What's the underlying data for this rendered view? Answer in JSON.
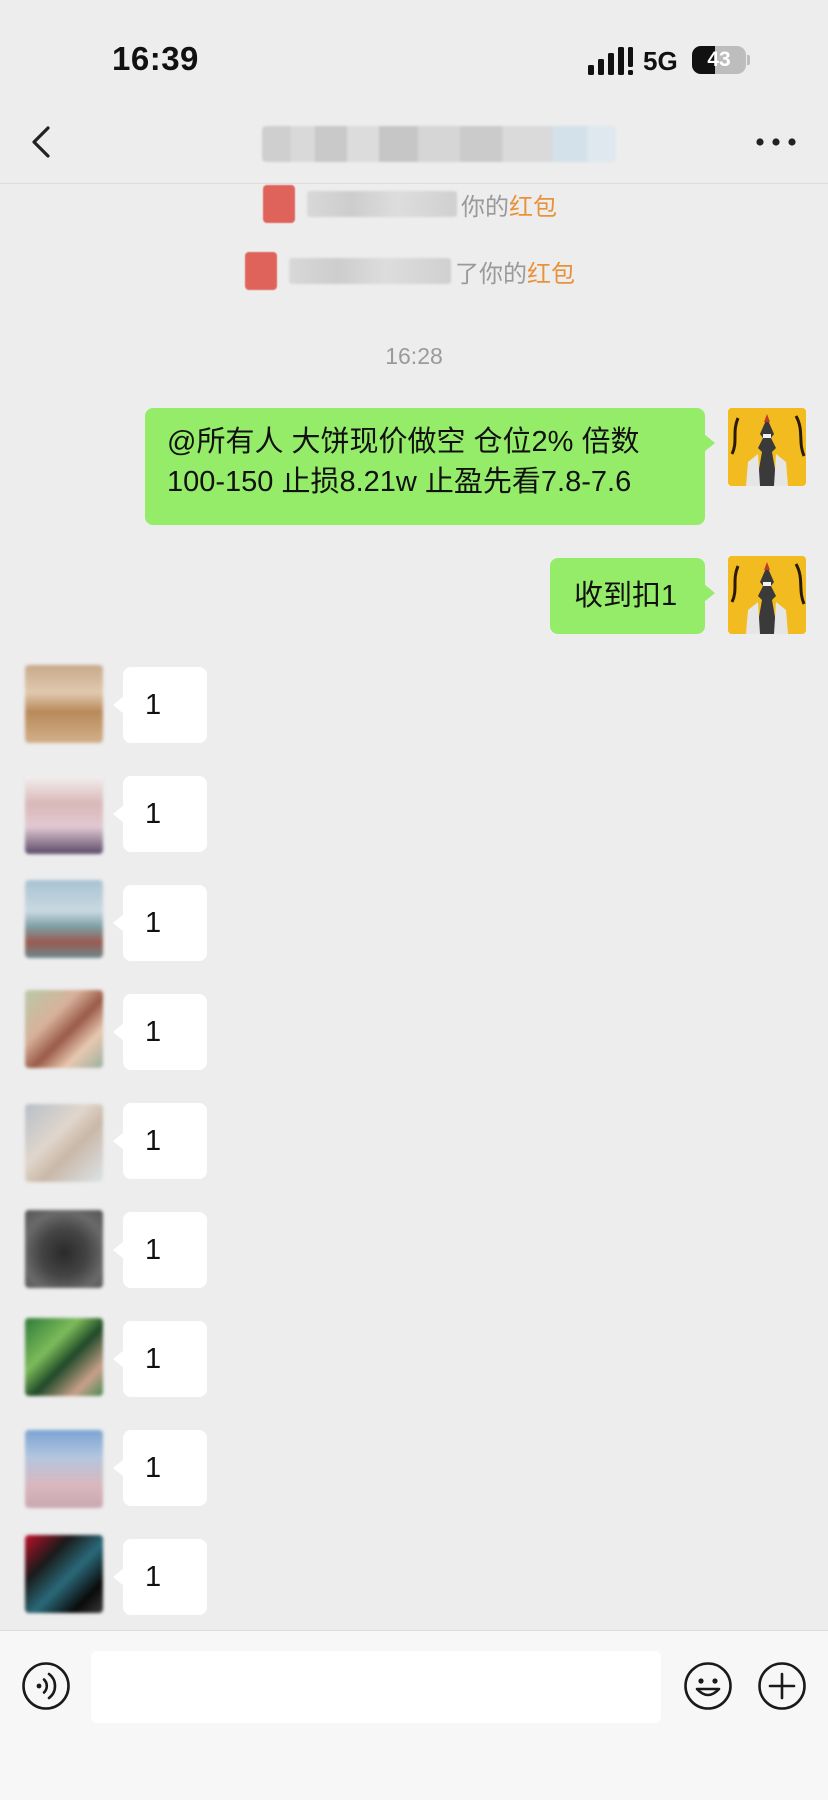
{
  "status_bar": {
    "time": "16:39",
    "network": "5G",
    "battery_percent": "43",
    "battery_fraction": 0.43,
    "signal_icon": "cellular-signal-icon"
  },
  "header": {
    "back_icon": "chevron-left-icon",
    "more_icon": "more-dots-icon"
  },
  "system_messages": [
    {
      "text": "你的",
      "link": "红包",
      "icon": "red-packet-icon"
    },
    {
      "text": "了你的",
      "link": "红包",
      "icon": "red-packet-icon"
    }
  ],
  "time_divider": "16:28",
  "outgoing_messages": [
    {
      "lines": [
        "@所有人 大饼现价做空 仓位2% 倍数",
        "100-150 止损8.21w 止盈先看7.8-7.6"
      ]
    },
    {
      "lines": [
        "收到扣1"
      ]
    }
  ],
  "incoming_messages": [
    {
      "text": "1"
    },
    {
      "text": "1"
    },
    {
      "text": "1"
    },
    {
      "text": "1"
    },
    {
      "text": "1"
    },
    {
      "text": "1"
    },
    {
      "text": "1"
    },
    {
      "text": "1"
    },
    {
      "text": "1"
    }
  ],
  "input_bar": {
    "voice_icon": "voice-icon",
    "emoji_icon": "emoji-icon",
    "plus_icon": "plus-icon",
    "input_value": ""
  },
  "colors": {
    "background": "#ededed",
    "outgoing_bubble": "#95ec69",
    "incoming_bubble": "#ffffff",
    "red_packet_link": "#e8923b",
    "system_text": "#9a9a9a"
  }
}
